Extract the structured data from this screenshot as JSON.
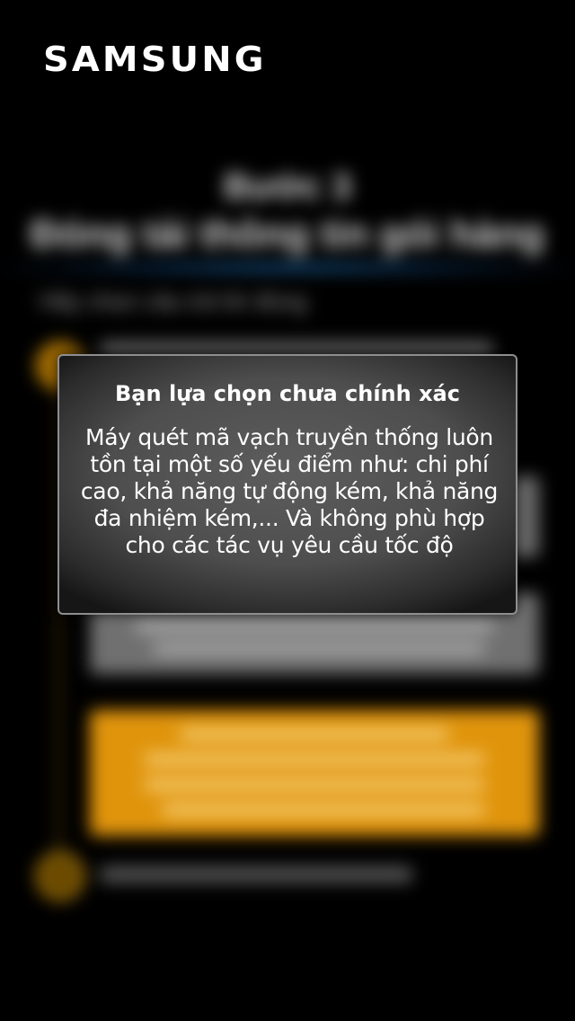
{
  "header": {
    "brand": "SAMSUNG"
  },
  "background": {
    "step_label": "Bước 3",
    "step_title": "Đóng tải thông tin gói hàng",
    "instruction": "Hãy chọn câu trả lời đúng",
    "colors": {
      "accent": "#e0940c",
      "glow": "#2896dc"
    }
  },
  "modal": {
    "title": "Bạn lựa chọn chưa chính xác",
    "body": "Máy quét mã vạch truyền thống luôn tồn tại một số yếu điểm như: chi phí cao, khả năng tự động kém, khả năng đa nhiệm kém,... Và không phù hợp cho các tác vụ yêu cầu tốc độ"
  }
}
